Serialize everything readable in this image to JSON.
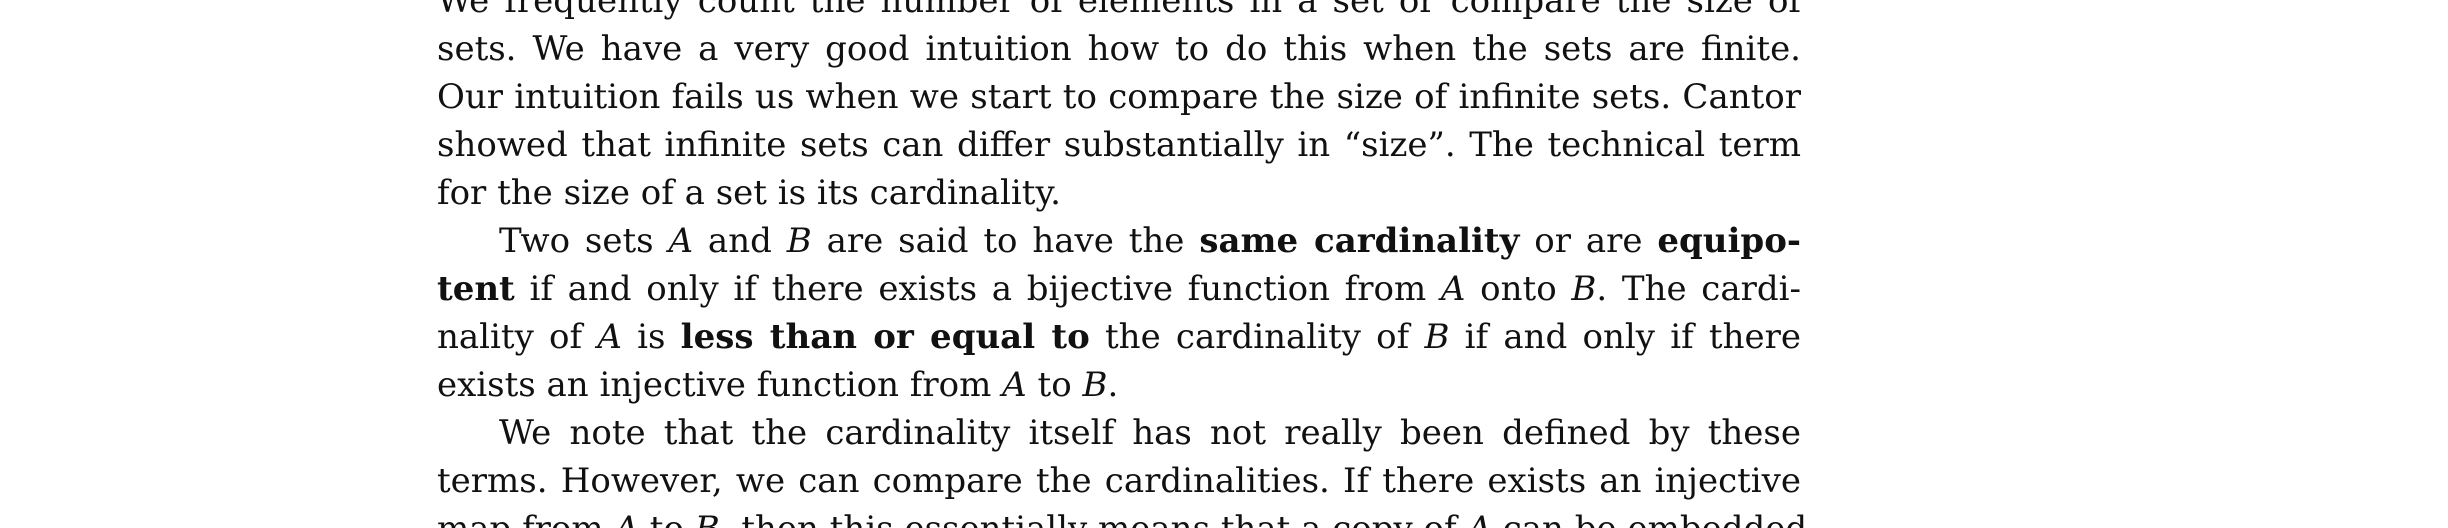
{
  "paragraphs": [
    {
      "indent": false,
      "lines": [
        [
          {
            "t": "We frequently count the number of elements in a set or compare the size of"
          }
        ],
        [
          {
            "t": "sets.  We have a very good intuition how to do this when the sets are finite."
          }
        ],
        [
          {
            "t": "Our intuition fails us when we start to compare the size of infinite sets. Cantor"
          }
        ],
        [
          {
            "t": "showed that infinite sets can differ substantially in “size”. The technical term"
          }
        ],
        [
          {
            "t": "for the size of a set is its cardinality."
          }
        ]
      ]
    },
    {
      "indent": true,
      "lines": [
        [
          {
            "t": "Two sets "
          },
          {
            "t": "A",
            "s": "m"
          },
          {
            "t": " and "
          },
          {
            "t": "B",
            "s": "m"
          },
          {
            "t": " are said to have the "
          },
          {
            "t": "same cardinality",
            "s": "b"
          },
          {
            "t": " or are "
          },
          {
            "t": "equipo-",
            "s": "b"
          }
        ],
        [
          {
            "t": "tent",
            "s": "b"
          },
          {
            "t": " if and only if there exists a bijective function from "
          },
          {
            "t": "A",
            "s": "m"
          },
          {
            "t": " onto "
          },
          {
            "t": "B",
            "s": "m"
          },
          {
            "t": ". The cardi-"
          }
        ],
        [
          {
            "t": "nality of "
          },
          {
            "t": "A",
            "s": "m"
          },
          {
            "t": " is "
          },
          {
            "t": "less than or equal to",
            "s": "b"
          },
          {
            "t": " the cardinality of "
          },
          {
            "t": "B",
            "s": "m"
          },
          {
            "t": " if and only if there"
          }
        ],
        [
          {
            "t": "exists an injective function from "
          },
          {
            "t": "A",
            "s": "m"
          },
          {
            "t": " to "
          },
          {
            "t": "B",
            "s": "m"
          },
          {
            "t": "."
          }
        ]
      ]
    },
    {
      "indent": true,
      "lines": [
        [
          {
            "t": "We note that the cardinality itself has not really been defined by these"
          }
        ],
        [
          {
            "t": "terms. However, we can compare the cardinalities. If there exists an injective"
          }
        ],
        [
          {
            "t": "map from "
          },
          {
            "t": "A",
            "s": "m"
          },
          {
            "t": " to "
          },
          {
            "t": "B",
            "s": "m"
          },
          {
            "t": ", then this essentially means that a copy of "
          },
          {
            "t": "A",
            "s": "m"
          },
          {
            "t": " can be embedded"
          }
        ]
      ]
    }
  ]
}
